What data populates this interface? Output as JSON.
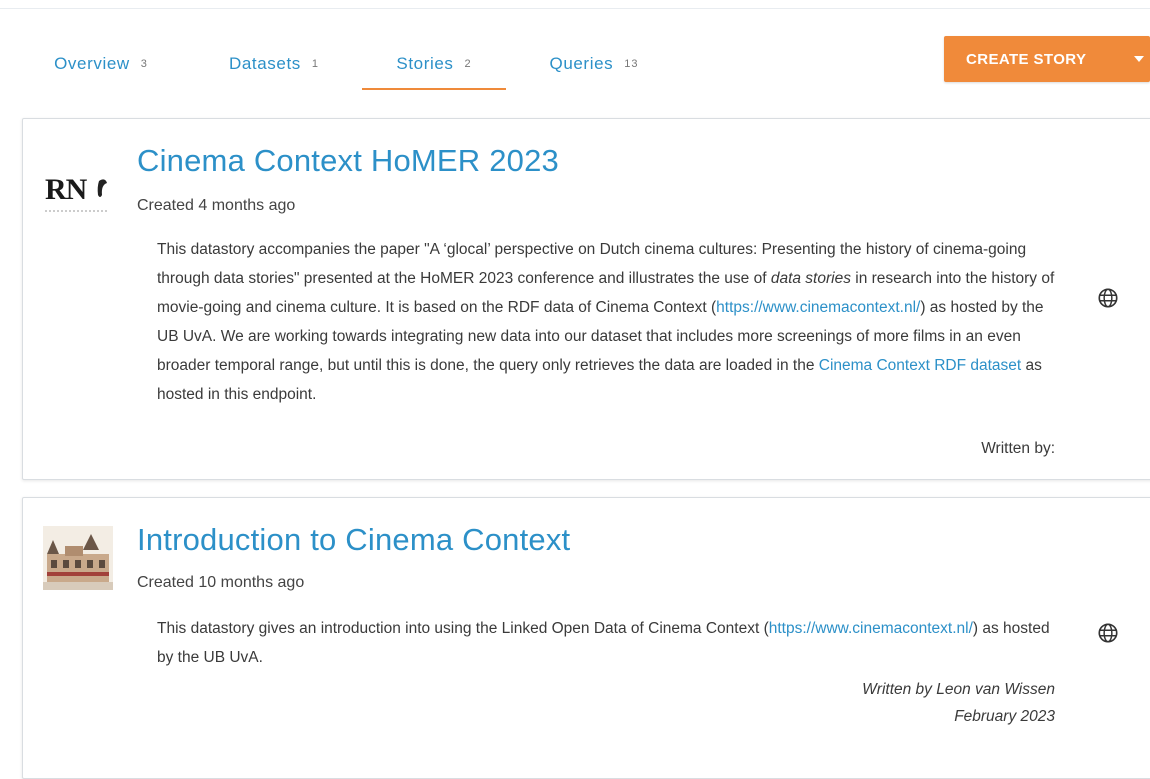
{
  "tabs": [
    {
      "label": "Overview",
      "count": "3"
    },
    {
      "label": "Datasets",
      "count": "1"
    },
    {
      "label": "Stories",
      "count": "2",
      "active": true
    },
    {
      "label": "Queries",
      "count": "13"
    }
  ],
  "toolbar": {
    "create_label": "CREATE STORY"
  },
  "colors": {
    "accent": "#f08a3a",
    "link": "#2c90c8"
  },
  "stories": [
    {
      "title": "Cinema Context HoMER 2023",
      "created": "Created 4 months ago",
      "avatar_text": "RN",
      "desc": {
        "p1": "This datastory accompanies the paper \"A ‘glocal’ perspective on Dutch cinema cultures: Presenting the history of cinema-going through data stories\" presented at the HoMER 2023 conference and illustrates the use of ",
        "em": "data stories",
        "p2": " in research into the history of movie-going and cinema culture. It is based on the RDF data of Cinema Context (",
        "link1": "https://www.cinemacontext.nl/",
        "p3": ") as hosted by the UB UvA. We are working towards integrating new data into our dataset that includes more screenings of more films in an even broader temporal range, but until this is done, the query only retrieves the data are loaded in the ",
        "link2": "Cinema Context RDF dataset",
        "p4": " as hosted in this endpoint."
      },
      "byline": "Written by:",
      "icon": "globe-icon"
    },
    {
      "title": "Introduction to Cinema Context",
      "created": "Created 10 months ago",
      "desc": {
        "p1": "This datastory gives an introduction into using the Linked Open Data of Cinema Context (",
        "link1": "https://www.cinemacontext.nl/",
        "p2": ") as hosted by the UB UvA."
      },
      "byline_author": "Written by Leon van Wissen",
      "byline_date": "February 2023",
      "icon": "globe-icon"
    }
  ]
}
